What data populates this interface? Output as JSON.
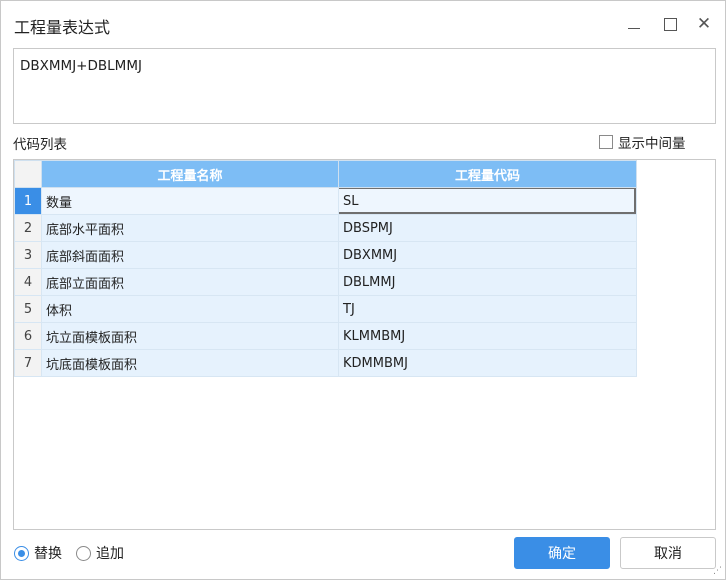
{
  "window": {
    "title": "工程量表达式"
  },
  "expression": {
    "value": "DBXMMJ+DBLMMJ"
  },
  "code_list": {
    "label": "代码列表",
    "show_intermediate_label": "显示中间量",
    "show_intermediate_checked": false,
    "columns": [
      "工程量名称",
      "工程量代码"
    ],
    "rows": [
      {
        "num": "1",
        "name": "数量",
        "code": "SL",
        "selected": true
      },
      {
        "num": "2",
        "name": "底部水平面积",
        "code": "DBSPMJ"
      },
      {
        "num": "3",
        "name": "底部斜面面积",
        "code": "DBXMMJ"
      },
      {
        "num": "4",
        "name": "底部立面面积",
        "code": "DBLMMJ"
      },
      {
        "num": "5",
        "name": "体积",
        "code": "TJ"
      },
      {
        "num": "6",
        "name": "坑立面模板面积",
        "code": "KLMMBMJ"
      },
      {
        "num": "7",
        "name": "坑底面模板面积",
        "code": "KDMMBMJ"
      }
    ]
  },
  "mode": {
    "replace_label": "替换",
    "append_label": "追加",
    "selected": "replace"
  },
  "buttons": {
    "ok_label": "确定",
    "cancel_label": "取消"
  },
  "colors": {
    "accent": "#3a8ee6",
    "header": "#7dbdf5",
    "row_bg": "#e6f2fd"
  }
}
